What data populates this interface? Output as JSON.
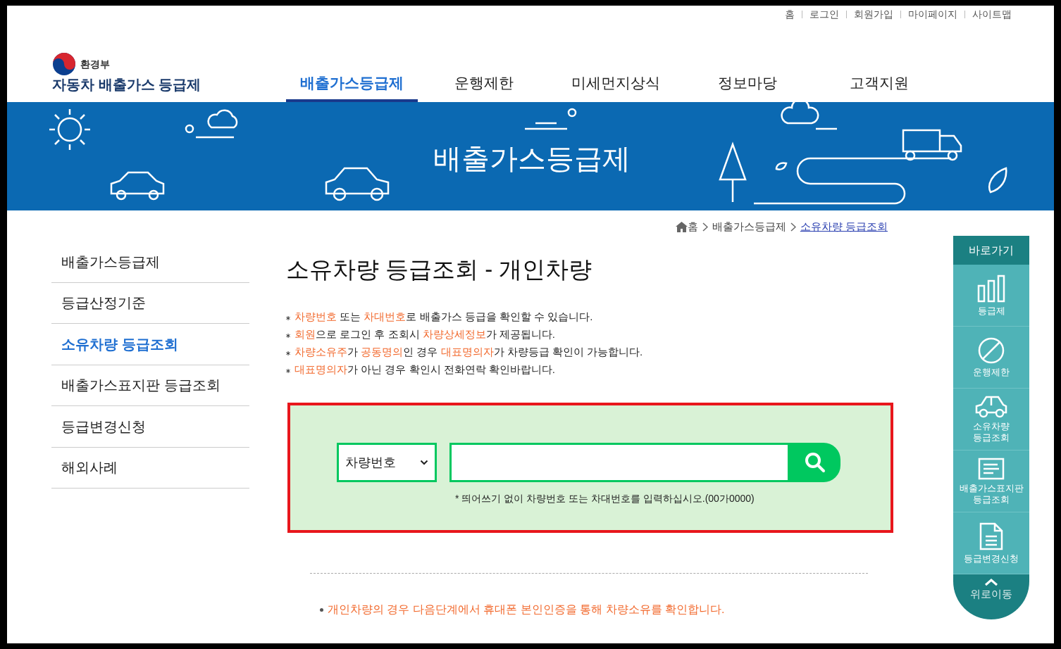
{
  "top_links": [
    "홈",
    "로그인",
    "회원가입",
    "마이페이지",
    "사이트맵"
  ],
  "logo": {
    "ministry": "환경부",
    "title": "자동차 배출가스 등급제"
  },
  "nav": [
    {
      "label": "배출가스등급제",
      "selected": true
    },
    {
      "label": "운행제한",
      "selected": false
    },
    {
      "label": "미세먼지상식",
      "selected": false
    },
    {
      "label": "정보마당",
      "selected": false
    },
    {
      "label": "고객지원",
      "selected": false
    }
  ],
  "banner": {
    "title": "배출가스등급제"
  },
  "breadcrumb": [
    {
      "label": "홈",
      "current": false
    },
    {
      "label": "배출가스등급제",
      "current": false
    },
    {
      "label": "소유차량 등급조회",
      "current": true
    }
  ],
  "sidebar": {
    "items": [
      {
        "label": "배출가스등급제",
        "selected": false
      },
      {
        "label": "등급산정기준",
        "selected": false
      },
      {
        "label": "소유차량 등급조회",
        "selected": true
      },
      {
        "label": "배출가스표지판 등급조회",
        "selected": false
      },
      {
        "label": "등급변경신청",
        "selected": false
      },
      {
        "label": "해외사례",
        "selected": false
      }
    ]
  },
  "page_title": "소유차량 등급조회 - 개인차량",
  "notices": [
    [
      {
        "text": "차량번호",
        "highlight": true
      },
      {
        "text": " 또는 ",
        "highlight": false
      },
      {
        "text": "차대번호",
        "highlight": true
      },
      {
        "text": "로 배출가스 등급을 확인할 수 있습니다.",
        "highlight": false
      }
    ],
    [
      {
        "text": "회원",
        "highlight": true
      },
      {
        "text": "으로 로그인 후 조회시 ",
        "highlight": false
      },
      {
        "text": "차량상세정보",
        "highlight": true
      },
      {
        "text": "가 제공됩니다.",
        "highlight": false
      }
    ],
    [
      {
        "text": "차량소유주",
        "highlight": true
      },
      {
        "text": "가 ",
        "highlight": false
      },
      {
        "text": "공동명의",
        "highlight": true
      },
      {
        "text": "인 경우 ",
        "highlight": false
      },
      {
        "text": "대표명의자",
        "highlight": true
      },
      {
        "text": "가 차량등급 확인이 가능합니다.",
        "highlight": false
      }
    ],
    [
      {
        "text": "대표명의자",
        "highlight": true
      },
      {
        "text": "가 아닌 경우 확인시 전화연락 확인바랍니다.",
        "highlight": false
      }
    ]
  ],
  "search": {
    "select_value": "차량번호",
    "hint": "* 띄어쓰기 없이 차량번호 또는 차대번호를 입력하십시오.(00가0000)"
  },
  "bottom_note": "개인차량의 경우 다음단계에서 휴대폰 본인인증을 통해 차량소유를 확인합니다.",
  "quick_menu": {
    "title": "바로가기",
    "items": [
      {
        "kind": "chart",
        "label": "등급제"
      },
      {
        "kind": "ban",
        "label": "운행제한"
      },
      {
        "kind": "car",
        "label": "소유차량\n등급조회"
      },
      {
        "kind": "sign",
        "label": "배출가스표지판\n등급조회"
      },
      {
        "kind": "doc",
        "label": "등급변경신청"
      }
    ],
    "top_label": "위로이동"
  }
}
